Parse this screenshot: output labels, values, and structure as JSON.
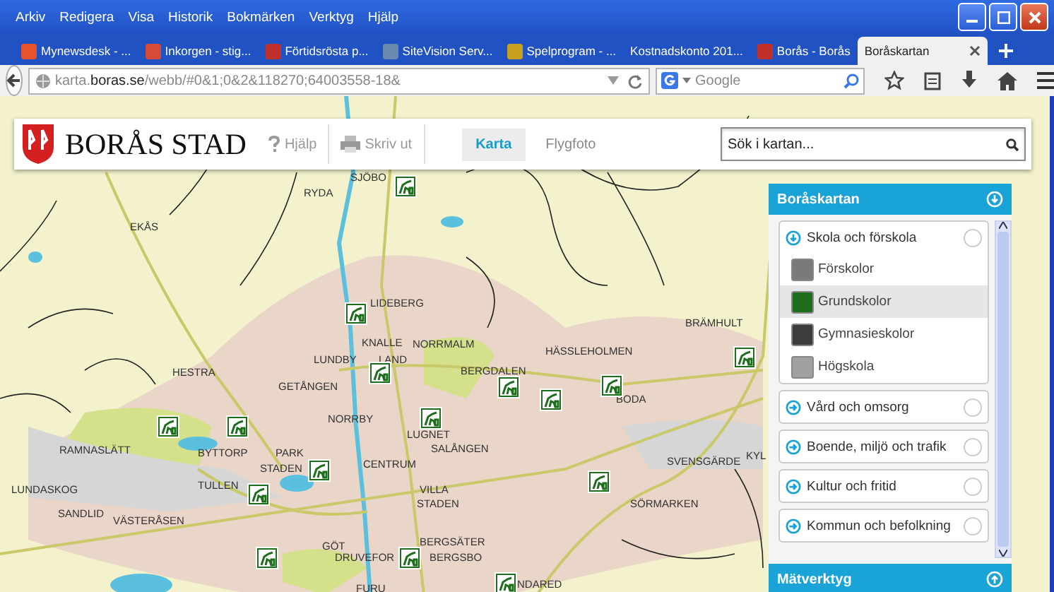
{
  "browser": {
    "menu": [
      "Arkiv",
      "Redigera",
      "Visa",
      "Historik",
      "Bokmärken",
      "Verktyg",
      "Hjälp"
    ],
    "tabs": [
      {
        "label": "Mynewsdesk - ...",
        "selected": false,
        "favicon": true
      },
      {
        "label": "Inkorgen - stig...",
        "selected": false,
        "favicon": true
      },
      {
        "label": "Förtidsrösta p...",
        "selected": false,
        "favicon": true
      },
      {
        "label": "SiteVision Serv...",
        "selected": false,
        "favicon": true
      },
      {
        "label": "Spelprogram - ...",
        "selected": false,
        "favicon": true
      },
      {
        "label": "Kostnadskonto 201...",
        "selected": false,
        "favicon": false
      },
      {
        "label": "Borås - Borås",
        "selected": false,
        "favicon": true
      },
      {
        "label": "Boråskartan",
        "selected": true,
        "favicon": false
      }
    ],
    "address": "karta.**boras.se**/webb/#0&1;0&2&118270;64003558-18&",
    "search": {
      "placeholder": "Google"
    }
  },
  "site": {
    "logo": "BORÅS STAD",
    "help": "Hjälp",
    "print": "Skriv ut",
    "views": [
      {
        "label": "Karta",
        "selected": true
      },
      {
        "label": "Flygfoto",
        "selected": false
      }
    ],
    "search": {
      "placeholder": "Sök i kartan..."
    }
  },
  "map": {
    "labels": [
      "SJÖBO",
      "RYDA",
      "EKÅS",
      "LIDEBERG",
      "BRÄMHULT",
      "KNALLE",
      "NORRMALM",
      "HÄSSLEHOLMEN",
      "LUNDBY",
      "LAND",
      "BERGDALEN",
      "HESTRA",
      "GETÅNGEN",
      "BODA",
      "NORRBY",
      "LUGNET",
      "RAMNASLÄTT",
      "BYTTORP",
      "PARK",
      "SALÅNGEN",
      "KYL",
      "STADEN",
      "CENTRUM",
      "SVENSGÄRDE",
      "LUNDASKOG",
      "TULLEN",
      "VILLA",
      "STADEN",
      "SÖRMARKEN",
      "SANDLID",
      "VÄSTERÅSEN",
      "GÖT",
      "BERGSÄTER",
      "DRUVEFOR",
      "BERGSBO",
      "FURU",
      "NDARED"
    ]
  },
  "panel": {
    "title": "Boråskartan",
    "footer": "Mätverktyg",
    "groups": [
      {
        "label": "Skola och förskola",
        "expanded": true,
        "children": [
          {
            "label": "Förskolor",
            "selected": false,
            "color": "#7a7a7a"
          },
          {
            "label": "Grundskolor",
            "selected": true,
            "color": "#1e6e1e"
          },
          {
            "label": "Gymnasieskolor",
            "selected": false,
            "color": "#3c3c3c"
          },
          {
            "label": "Högskola",
            "selected": false,
            "color": "#a0a0a0"
          }
        ]
      },
      {
        "label": "Vård och omsorg",
        "expanded": false
      },
      {
        "label": "Boende, miljö och trafik",
        "expanded": false
      },
      {
        "label": "Kultur och fritid",
        "expanded": false
      },
      {
        "label": "Kommun och befolkning",
        "expanded": false
      }
    ]
  }
}
